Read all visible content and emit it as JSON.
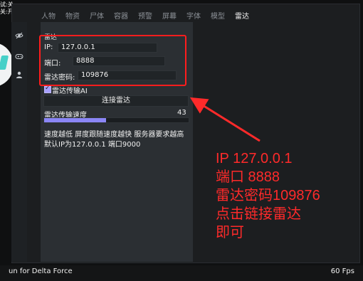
{
  "status": {
    "lines": [
      "试:关",
      "关:开"
    ]
  },
  "tabs": [
    {
      "label": "人物"
    },
    {
      "label": "物资"
    },
    {
      "label": "尸体"
    },
    {
      "label": "容器"
    },
    {
      "label": "预警"
    },
    {
      "label": "屏幕"
    },
    {
      "label": "字体"
    },
    {
      "label": "模型"
    },
    {
      "label": "雷达"
    }
  ],
  "radar": {
    "section_title": "雷达",
    "ip_label": "IP:",
    "ip_value": "127.0.0.1",
    "port_label": "端口:",
    "port_value": "8888",
    "password_label": "雷达密码:",
    "password_value": "109876",
    "ai_checkbox_label": "雷达传输AI",
    "connect_button": "连接雷达",
    "speed_label": "雷达传输速度",
    "speed_value": "43",
    "speed_fraction": 0.43,
    "notes": [
      "速度越低 屏度跟随速度越快 服务器要求越高",
      "默认IP为127.0.0.1 端口9000"
    ]
  },
  "annotation": {
    "lines": [
      "IP 127.0.0.1",
      "端口 8888",
      "雷达密码109876",
      "点击链接雷达",
      "即可"
    ],
    "color": "#ff2a2a"
  },
  "footer": {
    "left": "un for Delta Force",
    "right": "60 Fps"
  },
  "icons": {
    "sidebar": [
      "eye-off-icon",
      "gamepad-icon",
      "user-icon"
    ],
    "top_left": "double-chevron-icon"
  }
}
